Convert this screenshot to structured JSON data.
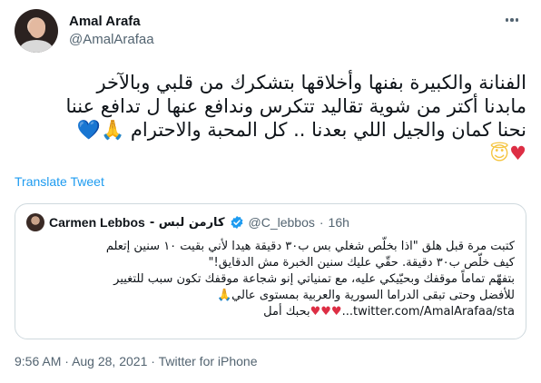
{
  "author": {
    "display_name": "Amal Arafa",
    "handle": "@AmalArafaa"
  },
  "tweet": {
    "lines": [
      "الفنانة والكبيرة بفنها وأخلاقها بتشكرك من قلبي وبالآخر",
      "مابدنا أكتر من شوية تقاليد تتكرس وندافع عنها ل تدافع عننا",
      "نحنا كمان والجيل اللي بعدنا .. كل المحبة والاحترام"
    ],
    "line3_emojis": {
      "hands": "🙏",
      "blue_heart": "💙"
    },
    "line4_emojis": {
      "red_heart": "♥",
      "halo": "😇"
    }
  },
  "translate_label": "Translate Tweet",
  "quote": {
    "name": "Carmen Lebbos",
    "name_ar": "- كارمن لبس",
    "handle": "@C_lebbos",
    "dot": "·",
    "time": "16h",
    "lines": [
      "كتبت مرة قبل هلق \"اذا بخلّص شغلي بس ب٣٠ دقيقة هيدا لأني بقيت ١٠ سنين إتعلم",
      "كيف خلّص ب٣٠ دقيقة. حقّي عليك سنين الخبرة مش الدقايق!\"",
      "بتفهّم تماماً موقفك وبحيّيكي عليه، مع تمنياتي إنو شجاعة موقفك تكون سبب للتغيير",
      "للأفضل وحتى تبقى الدراما السورية والعربية بمستوى عالي🙏",
      "twitter.com/AmalArafaa/sta...",
      "بحبك أمل"
    ],
    "hearts": "♥♥♥"
  },
  "meta": {
    "time": "9:56 AM",
    "sep1": "·",
    "date": "Aug 28, 2021",
    "sep2": "·",
    "source": "Twitter for iPhone"
  },
  "colors": {
    "link": "#1d9bf0",
    "secondary_text": "#536471",
    "heart_red": "#dd2e44",
    "heart_blue": "#5dadec",
    "verified": "#1d9bf0"
  }
}
